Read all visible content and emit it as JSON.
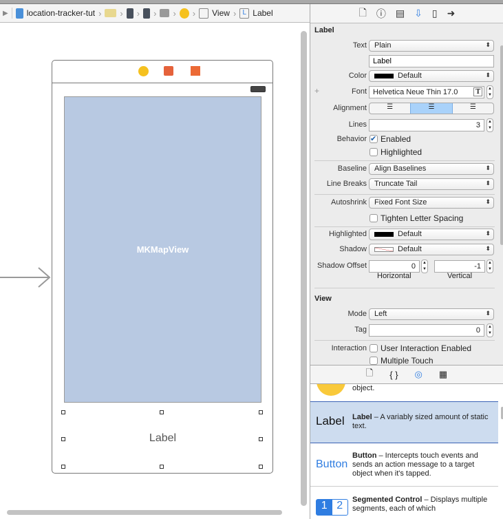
{
  "jumpbar": {
    "project": "location-tracker-tut",
    "items": [
      "View",
      "Label"
    ]
  },
  "canvas": {
    "map_view_label": "MKMapView",
    "label_text": "Label"
  },
  "inspector": {
    "tabs": [
      "file-icon",
      "help-icon",
      "identity-icon",
      "attributes-icon",
      "size-icon",
      "connections-icon"
    ],
    "active_tab": "attributes-icon",
    "label_section": "Label",
    "text_label": "Text",
    "text_value": "Plain",
    "text_field": "Label",
    "color_label": "Color",
    "color_value": "Default",
    "font_label": "Font",
    "font_value": "Helvetica Neue Thin 17.0",
    "alignment_label": "Alignment",
    "alignment_value": "center",
    "lines_label": "Lines",
    "lines_value": "3",
    "behavior_label": "Behavior",
    "enabled": "Enabled",
    "enabled_checked": true,
    "highlighted": "Highlighted",
    "highlighted_checked": false,
    "baseline_label": "Baseline",
    "baseline_value": "Align Baselines",
    "linebreaks_label": "Line Breaks",
    "linebreaks_value": "Truncate Tail",
    "autoshrink_label": "Autoshrink",
    "autoshrink_value": "Fixed Font Size",
    "tighten": "Tighten Letter Spacing",
    "hl_label": "Highlighted",
    "hl_value": "Default",
    "shadow_label": "Shadow",
    "shadow_value": "Default",
    "shadow_offset_label": "Shadow Offset",
    "horizontal_value": "0",
    "vertical_value": "-1",
    "horizontal": "Horizontal",
    "vertical": "Vertical",
    "view_section": "View",
    "mode_label": "Mode",
    "mode_value": "Left",
    "tag_label": "Tag",
    "tag_value": "0",
    "interaction_label": "Interaction",
    "user_interaction": "User Interaction Enabled",
    "multiple_touch": "Multiple Touch"
  },
  "library": {
    "tabs": [
      "file-template-icon",
      "code-snippet-icon",
      "object-icon",
      "media-icon"
    ],
    "items": [
      {
        "desc": "object."
      },
      {
        "preview": "Label",
        "title": "Label",
        "desc": " – A variably sized amount of static text."
      },
      {
        "preview": "Button",
        "title": "Button",
        "desc": " – Intercepts touch events and sends an action message to a target object when it's tapped."
      },
      {
        "preview1": "1",
        "preview2": "2",
        "title": "Segmented Control",
        "desc": " – Displays multiple segments, each of which"
      }
    ]
  },
  "colors": {
    "accent": "#2f7de1",
    "map": "#b8c9e2",
    "selected_row": "#cddcef"
  }
}
